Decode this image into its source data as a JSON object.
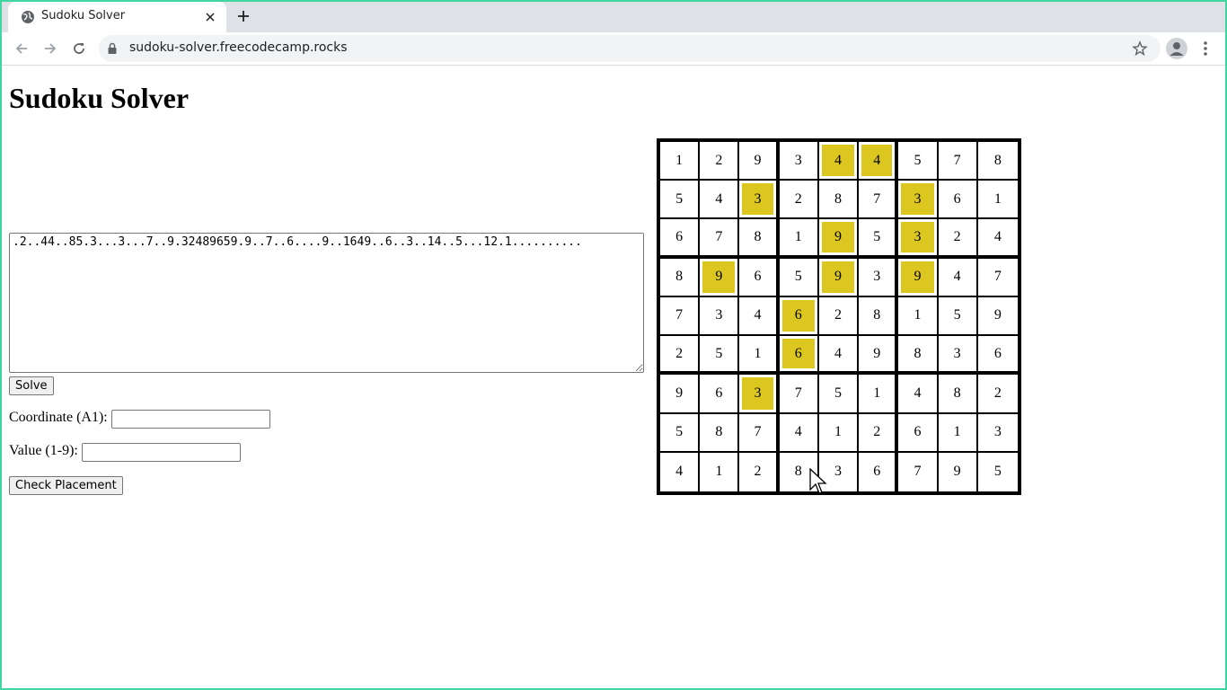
{
  "browser": {
    "tab_title": "Sudoku Solver",
    "url": "sudoku-solver.freecodecamp.rocks"
  },
  "page": {
    "title": "Sudoku Solver",
    "puzzle_string": ".2..44..85.3...3...7..9.32489659.9..7..6....9..1649..6..3..14..5...12.1..........",
    "solve_label": "Solve",
    "coordinate_label": "Coordinate (A1):",
    "coordinate_value": "",
    "value_label": "Value (1-9):",
    "value_value": "",
    "check_label": "Check Placement"
  },
  "grid": {
    "highlight_color": "#dcc620",
    "rows": [
      [
        1,
        2,
        9,
        3,
        4,
        4,
        5,
        7,
        8
      ],
      [
        5,
        4,
        3,
        2,
        8,
        7,
        3,
        6,
        1
      ],
      [
        6,
        7,
        8,
        1,
        9,
        5,
        3,
        2,
        4
      ],
      [
        8,
        9,
        6,
        5,
        9,
        3,
        9,
        4,
        7
      ],
      [
        7,
        3,
        4,
        6,
        2,
        8,
        1,
        5,
        9
      ],
      [
        2,
        5,
        1,
        6,
        4,
        9,
        8,
        3,
        6
      ],
      [
        9,
        6,
        3,
        7,
        5,
        1,
        4,
        8,
        2
      ],
      [
        5,
        8,
        7,
        4,
        1,
        2,
        6,
        1,
        3
      ],
      [
        4,
        1,
        2,
        8,
        3,
        6,
        7,
        9,
        5
      ]
    ],
    "highlighted": [
      [
        0,
        4
      ],
      [
        0,
        5
      ],
      [
        1,
        2
      ],
      [
        1,
        6
      ],
      [
        2,
        4
      ],
      [
        2,
        6
      ],
      [
        3,
        1
      ],
      [
        3,
        4
      ],
      [
        3,
        6
      ],
      [
        4,
        3
      ],
      [
        5,
        3
      ],
      [
        6,
        2
      ]
    ]
  }
}
